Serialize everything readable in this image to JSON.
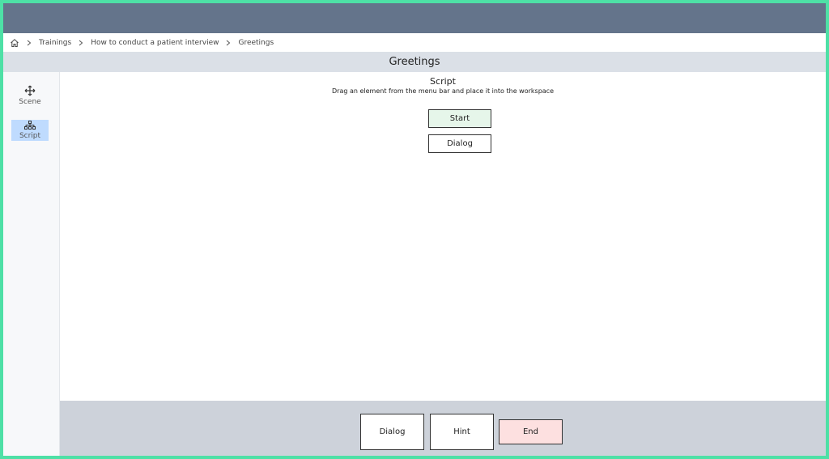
{
  "breadcrumb": {
    "items": [
      "Trainings",
      "How to conduct a patient interview",
      "Greetings"
    ]
  },
  "title": "Greetings",
  "sidebar": {
    "items": [
      {
        "label": "Scene",
        "icon": "move-icon"
      },
      {
        "label": "Script",
        "icon": "sitemap-icon"
      }
    ]
  },
  "workspace": {
    "title": "Script",
    "subtitle": "Drag an element from the menu bar and place it into the workspace",
    "nodes": [
      {
        "label": "Start"
      },
      {
        "label": "Dialog"
      }
    ]
  },
  "toolbar": {
    "dialog_label": "Dialog",
    "hint_label": "Hint",
    "end_label": "End"
  },
  "colors": {
    "topbar": "#64748b",
    "frame_border": "#4ee0a6",
    "active_sidebar": "#bfdbfe",
    "start_node": "#e6f6ea",
    "end_button": "#fde0e0"
  }
}
